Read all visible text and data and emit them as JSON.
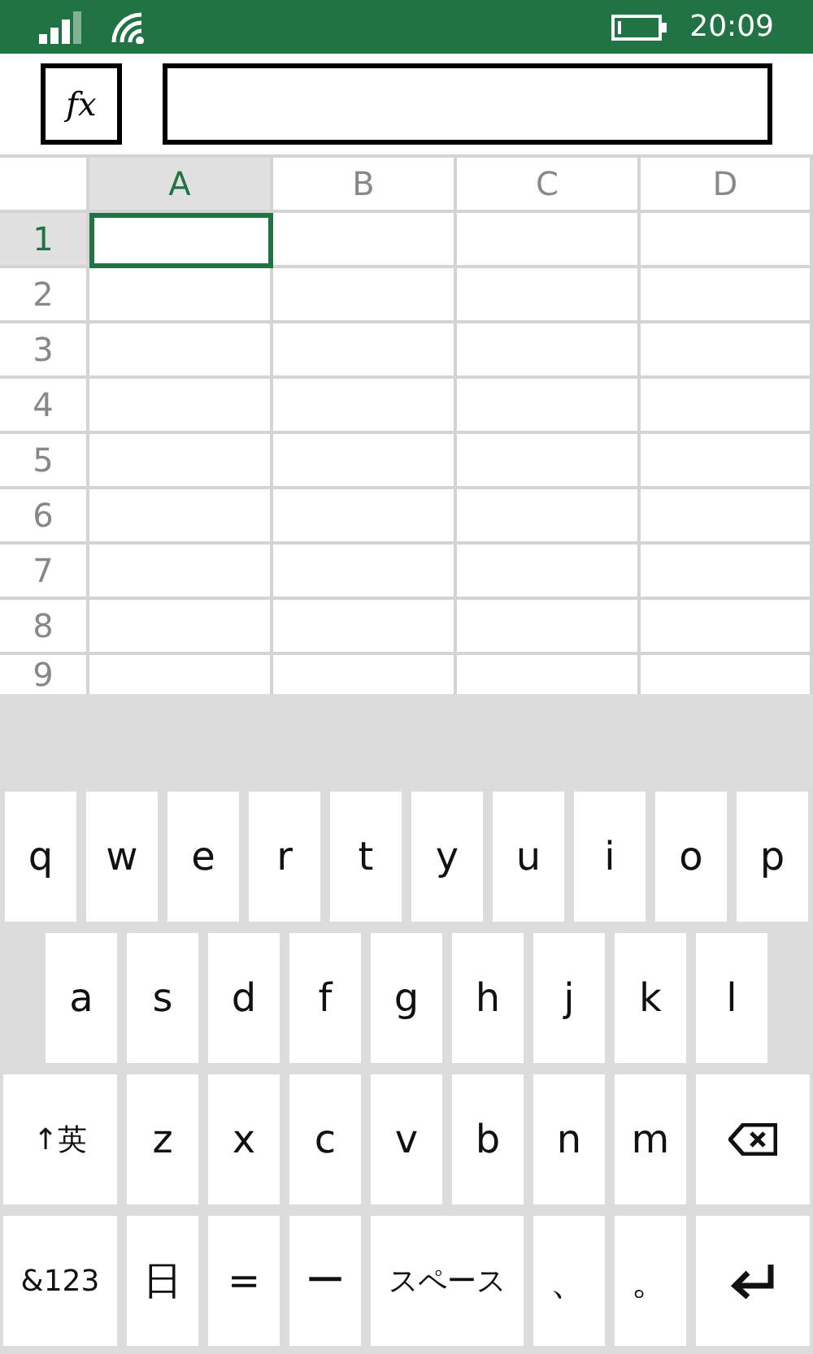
{
  "status_bar": {
    "time": "20:09"
  },
  "formula_bar": {
    "function_label": "fx"
  },
  "sheet": {
    "columns": [
      {
        "label": "A",
        "selected": true
      },
      {
        "label": "B",
        "selected": false
      },
      {
        "label": "C",
        "selected": false
      },
      {
        "label": "D",
        "selected": false
      }
    ],
    "rows": [
      {
        "label": "1",
        "selected": true
      },
      {
        "label": "2",
        "selected": false
      },
      {
        "label": "3",
        "selected": false
      },
      {
        "label": "4",
        "selected": false
      },
      {
        "label": "5",
        "selected": false
      },
      {
        "label": "6",
        "selected": false
      },
      {
        "label": "7",
        "selected": false
      },
      {
        "label": "8",
        "selected": false
      },
      {
        "label": "9",
        "selected": false
      }
    ]
  },
  "keyboard": {
    "rows": [
      [
        {
          "kind": "char",
          "label": "q"
        },
        {
          "kind": "char",
          "label": "w"
        },
        {
          "kind": "char",
          "label": "e"
        },
        {
          "kind": "char",
          "label": "r"
        },
        {
          "kind": "char",
          "label": "t"
        },
        {
          "kind": "char",
          "label": "y"
        },
        {
          "kind": "char",
          "label": "u"
        },
        {
          "kind": "char",
          "label": "i"
        },
        {
          "kind": "char",
          "label": "o"
        },
        {
          "kind": "char",
          "label": "p"
        }
      ],
      [
        {
          "kind": "char",
          "label": "a"
        },
        {
          "kind": "char",
          "label": "s"
        },
        {
          "kind": "char",
          "label": "d"
        },
        {
          "kind": "char",
          "label": "f"
        },
        {
          "kind": "char",
          "label": "g"
        },
        {
          "kind": "char",
          "label": "h"
        },
        {
          "kind": "char",
          "label": "j"
        },
        {
          "kind": "char",
          "label": "k"
        },
        {
          "kind": "char",
          "label": "l"
        }
      ],
      [
        {
          "kind": "wide",
          "label": "↑英"
        },
        {
          "kind": "char",
          "label": "z"
        },
        {
          "kind": "char",
          "label": "x"
        },
        {
          "kind": "char",
          "label": "c"
        },
        {
          "kind": "char",
          "label": "v"
        },
        {
          "kind": "char",
          "label": "b"
        },
        {
          "kind": "char",
          "label": "n"
        },
        {
          "kind": "char",
          "label": "m"
        },
        {
          "kind": "backspace"
        }
      ],
      [
        {
          "kind": "wide",
          "label": "&123"
        },
        {
          "kind": "char",
          "label": "日"
        },
        {
          "kind": "char",
          "label": "="
        },
        {
          "kind": "char",
          "label": "ー"
        },
        {
          "kind": "space",
          "label": "スペース"
        },
        {
          "kind": "char",
          "label": "、"
        },
        {
          "kind": "char",
          "label": "。"
        },
        {
          "kind": "enter"
        }
      ]
    ]
  }
}
